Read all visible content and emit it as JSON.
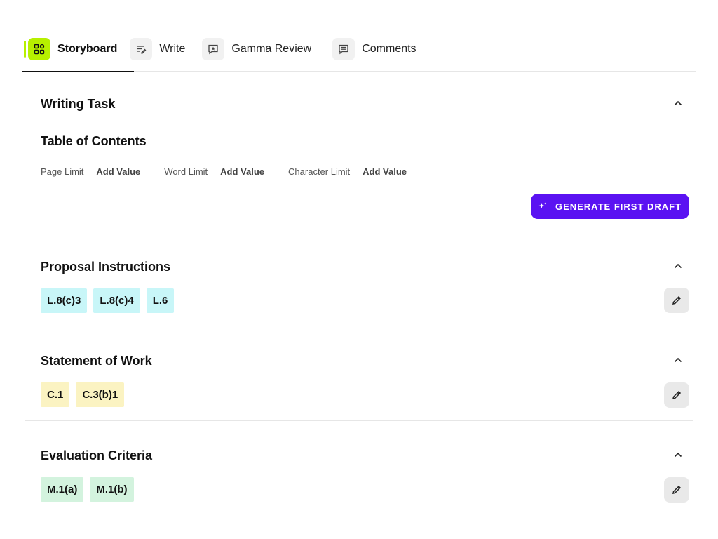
{
  "tabs": [
    {
      "label": "Storyboard",
      "icon": "grid-icon",
      "active": true
    },
    {
      "label": "Write",
      "icon": "write-icon",
      "active": false
    },
    {
      "label": "Gamma Review",
      "icon": "star-comment-icon",
      "active": false
    },
    {
      "label": "Comments",
      "icon": "comment-icon",
      "active": false
    }
  ],
  "writing_task": {
    "title": "Writing Task",
    "toc_title": "Table of Contents",
    "limits": [
      {
        "label": "Page Limit",
        "value": "Add Value"
      },
      {
        "label": "Word Limit",
        "value": "Add Value"
      },
      {
        "label": "Character Limit",
        "value": "Add Value"
      }
    ],
    "generate_label": "GENERATE FIRST DRAFT"
  },
  "proposal": {
    "title": "Proposal Instructions",
    "chips": [
      "L.8(c)3",
      "L.8(c)4",
      "L.6"
    ]
  },
  "sow": {
    "title": "Statement of Work",
    "chips": [
      "C.1",
      "C.3(b)1"
    ]
  },
  "evaluation": {
    "title": "Evaluation Criteria",
    "chips": [
      "M.1(a)",
      "M.1(b)"
    ]
  },
  "colors": {
    "accent": "#5a12f2",
    "active_tab": "#b7f000",
    "chip_cyan": "#c8f6f8",
    "chip_yellow": "#fbf3c2",
    "chip_green": "#d3f3de"
  }
}
